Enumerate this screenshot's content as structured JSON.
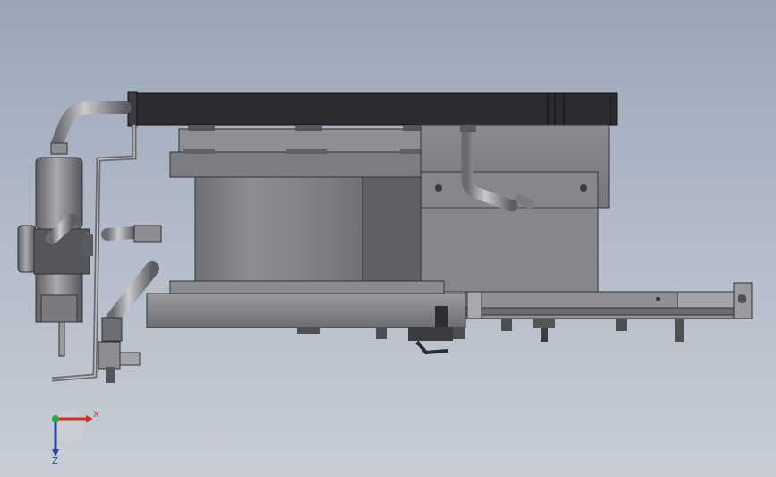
{
  "view": {
    "background_top": "#9aa6b8",
    "background_bottom": "#c8cdd6"
  },
  "triad": {
    "x_label": "X",
    "z_label": "Z",
    "x_color": "#d0312d",
    "y_color": "#2eaa3a",
    "z_color": "#2b3fa8"
  },
  "parts": [
    "top-plate",
    "clamp-block",
    "cylinder-drum",
    "base-flange",
    "side-housing",
    "bent-tube",
    "nozzle-assembly",
    "elbow-pipe",
    "angled-fitting",
    "linear-rail",
    "mounting-bracket",
    "fasteners"
  ]
}
